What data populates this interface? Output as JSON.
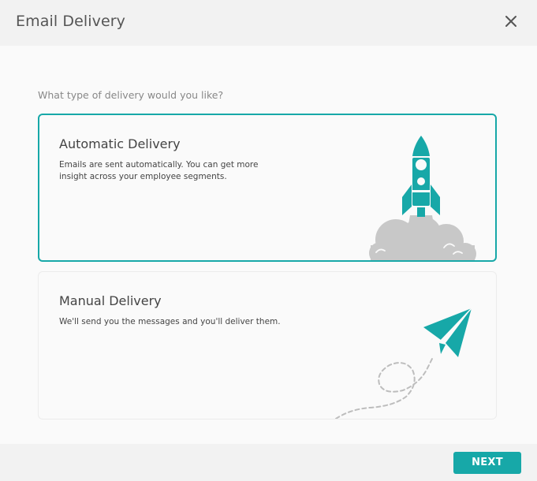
{
  "dialog": {
    "title": "Email Delivery",
    "close_icon": "close-icon"
  },
  "question": "What type of delivery would you like?",
  "options": [
    {
      "title": "Automatic Delivery",
      "description": "Emails are sent automatically. You can get more insight across your employee segments.",
      "selected": true,
      "icon": "rocket-icon"
    },
    {
      "title": "Manual Delivery",
      "description": "We'll send you the messages and you'll deliver them.",
      "selected": false,
      "icon": "paper-plane-icon"
    }
  ],
  "footer": {
    "next_label": "NEXT"
  },
  "colors": {
    "accent": "#17a8a8",
    "smoke": "#c8c8c8",
    "trail": "#bdbdbd"
  }
}
